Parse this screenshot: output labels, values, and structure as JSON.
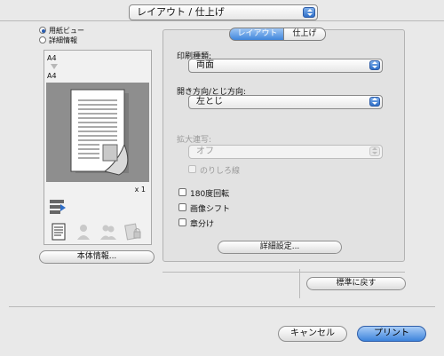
{
  "header": {
    "panel_select_value": "レイアウト / 仕上げ"
  },
  "left": {
    "radio_paper_view": "用紙ビュー",
    "radio_printer_view": "詳細情報",
    "paper_size_top": "A4",
    "paper_size_bottom": "A4",
    "copies": "x 1",
    "device_info_button": "本体情報..."
  },
  "tabs": [
    {
      "label": "レイアウト",
      "active": true
    },
    {
      "label": "仕上げ",
      "active": false
    }
  ],
  "form": {
    "print_type_label": "印刷種類:",
    "print_type_value": "両面",
    "binding_label": "開き方向/とじ方向:",
    "binding_value": "左とじ",
    "zoom_label": "拡大連写:",
    "zoom_value": "オフ",
    "margin_label": "のりしろ線",
    "rotate_180_label": "180度回転",
    "image_shift_label": "画像シフト",
    "chapters_label": "章分け",
    "details_button": "詳細設定..."
  },
  "footer": {
    "reset_button": "標準に戻す",
    "cancel_button": "キャンセル",
    "print_button": "プリント"
  },
  "colors": {
    "accent_blue": "#3d84dc",
    "window_bg": "#e9e9e9"
  }
}
